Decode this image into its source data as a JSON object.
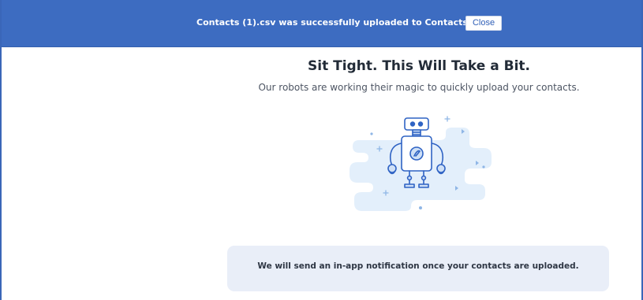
{
  "banner": {
    "message": "Contacts (1).csv was successfully uploaded to Contacts.",
    "close_label": "Close",
    "color": "#3d6cc1"
  },
  "main": {
    "title": "Sit Tight. This Will Take a Bit.",
    "subtitle": "Our robots are working their magic to quickly upload your contacts.",
    "illustration": "robot-icon"
  },
  "notice": {
    "message": "We will send an in-app notification once your contacts are uploaded."
  }
}
